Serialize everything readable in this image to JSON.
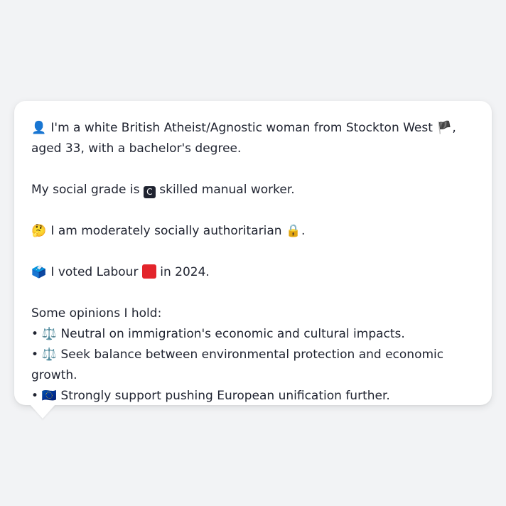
{
  "profile": {
    "intro_icon": "👤",
    "intro_text": "I'm a white British Atheist/Agnostic woman from Stockton West",
    "intro_flag": "🏴",
    "intro_tail": ", aged 33, with a bachelor's degree.",
    "social_grade_prefix": "My social grade is",
    "social_grade_badge": "C",
    "social_grade_suffix": "skilled manual worker.",
    "authoritarian_icon": "🤔",
    "authoritarian_text": "I am moderately socially authoritarian",
    "authoritarian_lock": "🔒",
    "authoritarian_end": ".",
    "vote_icon": "🗳️",
    "vote_prefix": "I voted Labour",
    "vote_suffix": "in 2024.",
    "opinions_heading": "Some opinions I hold:",
    "opinions": [
      {
        "bullet": "•",
        "icon": "⚖️",
        "text": "Neutral on immigration's economic and cultural impacts."
      },
      {
        "bullet": "•",
        "icon": "⚖️",
        "text": "Seek balance between environmental protection and economic growth."
      },
      {
        "bullet": "•",
        "icon": "🇪🇺",
        "text": "Strongly support pushing European unification further."
      }
    ]
  },
  "colors": {
    "background": "#f2f3f5",
    "bubble": "#ffffff",
    "labour_red": "#e3242b",
    "text": "#1f2330"
  }
}
